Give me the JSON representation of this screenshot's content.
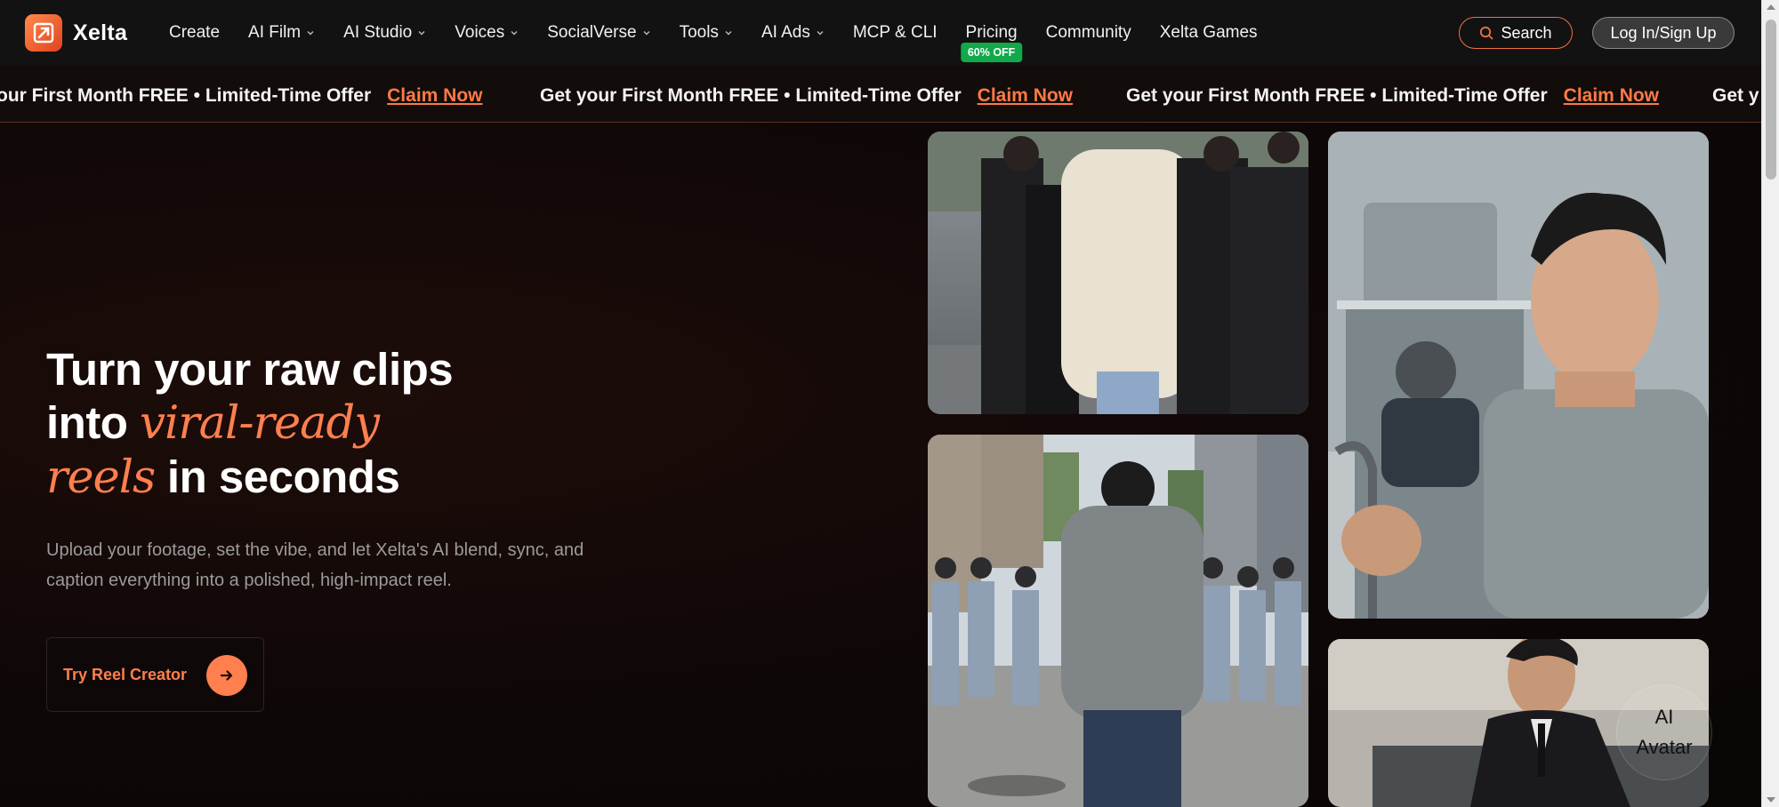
{
  "brand": {
    "name": "Xelta"
  },
  "nav": {
    "items": [
      {
        "label": "Create",
        "dropdown": false
      },
      {
        "label": "AI Film",
        "dropdown": true
      },
      {
        "label": "AI Studio",
        "dropdown": true
      },
      {
        "label": "Voices",
        "dropdown": true
      },
      {
        "label": "SocialVerse",
        "dropdown": true
      },
      {
        "label": "Tools",
        "dropdown": true
      },
      {
        "label": "AI Ads",
        "dropdown": true
      },
      {
        "label": "MCP & CLI",
        "dropdown": false
      },
      {
        "label": "Pricing",
        "dropdown": false,
        "badge": "60% OFF"
      },
      {
        "label": "Community",
        "dropdown": false
      },
      {
        "label": "Xelta Games",
        "dropdown": false
      }
    ],
    "search_label": "Search",
    "login_label": "Log In/Sign Up"
  },
  "promo": {
    "text": "Get your First Month FREE • Limited-Time Offer",
    "first_text": "our First Month FREE • Limited-Time Offer",
    "tail_text": "Get y",
    "link": "Claim Now"
  },
  "hero": {
    "line1": "Turn your raw clips",
    "line2_plain": "into ",
    "line2_accent": "viral-ready",
    "line3_accent": "reels",
    "line3_plain": " in seconds",
    "subtext": "Upload your footage, set the vibe, and let Xelta's AI blend, sync, and caption everything into a polished, high-impact reel.",
    "cta_label": "Try Reel Creator"
  },
  "ai_avatar": {
    "line1": "AI",
    "line2": "Avatar"
  },
  "colors": {
    "accent": "#ff7f4f",
    "badge": "#11a94a",
    "background": "#0d0707"
  }
}
